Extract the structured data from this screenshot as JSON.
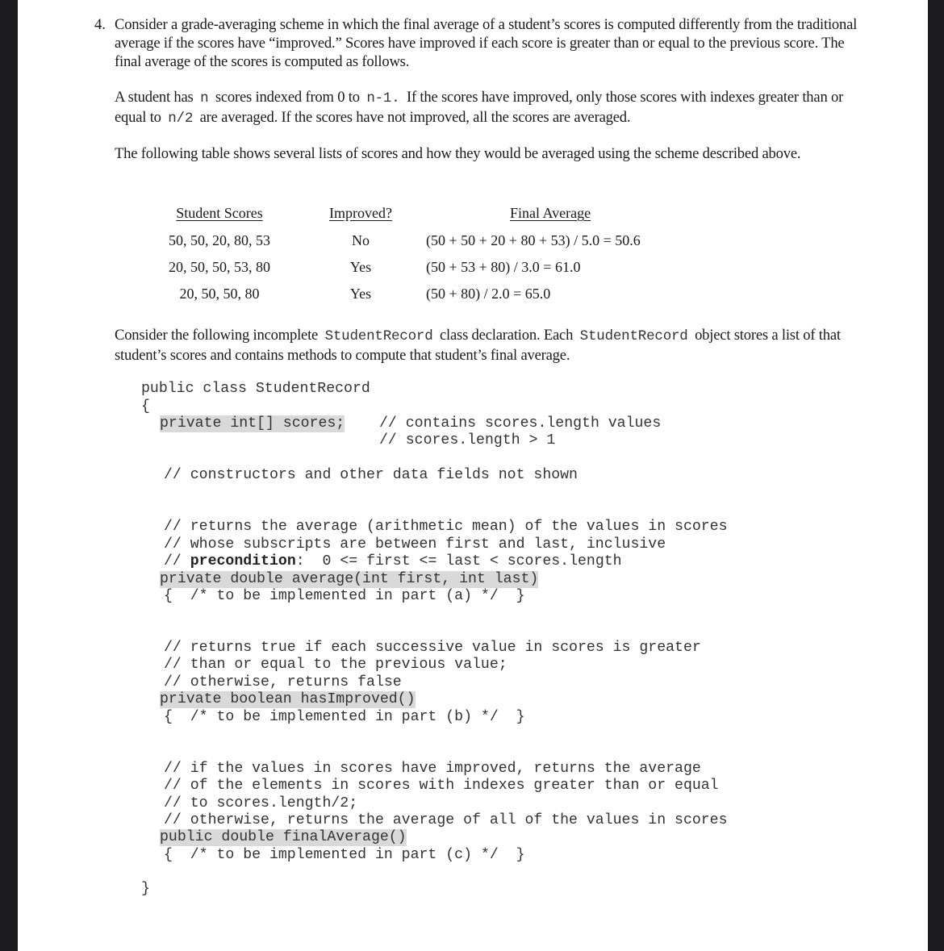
{
  "question": {
    "number": "4.",
    "intro": "Consider a grade-averaging scheme in which the final average of a student’s scores is computed differently from the traditional average if the scores have “improved.” Scores have improved if each score is greater than or equal to the previous score. The final average of the scores is computed as follows.",
    "rule": {
      "part1": "A student has",
      "code_n": "n",
      "part2": "scores indexed from 0 to",
      "code_n_minus_1": "n-1.",
      "part3": "If the scores have improved, only those scores with indexes greater than or equal to",
      "code_n_half": "n/2",
      "part4": "are averaged. If the scores have not improved, all the scores are averaged."
    },
    "table_intro": "The following table shows several lists of scores and how they would be averaged using the scheme described above.",
    "class_intro": {
      "part1": "Consider the following incomplete",
      "code1": "StudentRecord",
      "part2": "class declaration. Each",
      "code2": "StudentRecord",
      "part3": "object stores a list of that student’s scores and contains methods to compute that student’s final average."
    }
  },
  "table": {
    "headers": [
      "Student Scores",
      "Improved?",
      "Final Average"
    ],
    "rows": [
      {
        "scores": "50, 50, 20, 80, 53",
        "improved": "No",
        "final_average": "(50 + 50 + 20 + 80 + 53) / 5.0 = 50.6"
      },
      {
        "scores": "20, 50, 50, 53, 80",
        "improved": "Yes",
        "final_average": "(50 + 53 + 80) / 3.0 = 61.0"
      },
      {
        "scores": "20, 50, 50, 80",
        "improved": "Yes",
        "final_average": "(50 + 80) / 2.0 = 65.0"
      }
    ]
  },
  "code": {
    "class_decl": "public class StudentRecord",
    "open_brace": "{",
    "field_decl": "private int[] scores;",
    "field_comment_1": "// contains scores.length values",
    "field_comment_2": "// scores.length > 1",
    "constructors_comment": "// constructors and other data fields not shown",
    "average": {
      "comment_1": "// returns the average (arithmetic mean) of the values in scores",
      "comment_2": "// whose subscripts are between first and last, inclusive",
      "comment_3_prefix": "//",
      "comment_3_bold": "precondition",
      "comment_3_rest": ":  0 <= first <= last < scores.length",
      "signature": "private double average(int first, int last)",
      "body": "{  /* to be implemented in part (a) */  }"
    },
    "has_improved": {
      "comment_1": "// returns true if each successive value in scores is greater",
      "comment_2": "// than or equal to the previous value;",
      "comment_3": "// otherwise, returns false",
      "signature": "private boolean hasImproved()",
      "body": "{  /* to be implemented in part (b) */  }"
    },
    "final_average": {
      "comment_1": "// if the values in scores have improved, returns the average",
      "comment_2": "// of the elements in scores with indexes greater than or equal",
      "comment_3": "// to scores.length/2;",
      "comment_4": "// otherwise, returns the average of all of the values in scores",
      "signature": "public double finalAverage()",
      "body": "{  /* to be implemented in part (c) */  }"
    },
    "close_brace": "}"
  }
}
